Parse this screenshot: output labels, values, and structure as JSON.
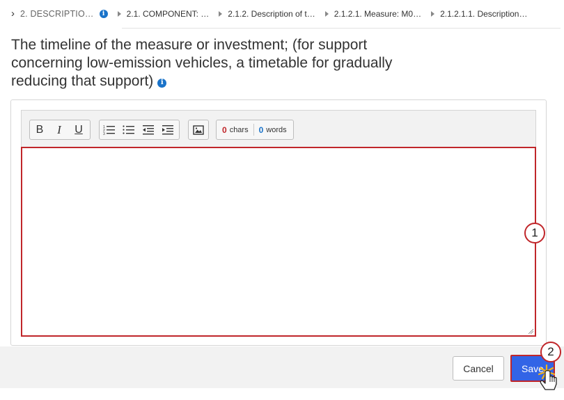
{
  "breadcrumb": {
    "items": [
      "2. DESCRIPTIO…",
      "2.1. COMPONENT: …",
      "2.1.2. Description of t…",
      "2.1.2.1. Measure: M0…",
      "2.1.2.1.1. Description…"
    ]
  },
  "title": "The timeline of the measure or investment; (for support concerning low-emission vehicles, a timetable for gradually reducing that support)",
  "toolbar": {
    "bold_label": "B",
    "italic_label": "I",
    "underline_label": "U",
    "chars_count": "0",
    "chars_label": "chars",
    "words_count": "0",
    "words_label": "words"
  },
  "editor": {
    "value": ""
  },
  "callouts": {
    "editor": "1",
    "save": "2"
  },
  "footer": {
    "cancel_label": "Cancel",
    "save_label": "Save"
  },
  "colors": {
    "accent_blue": "#3264e6",
    "highlight_red": "#c0262a",
    "info_blue": "#1a73c9"
  }
}
